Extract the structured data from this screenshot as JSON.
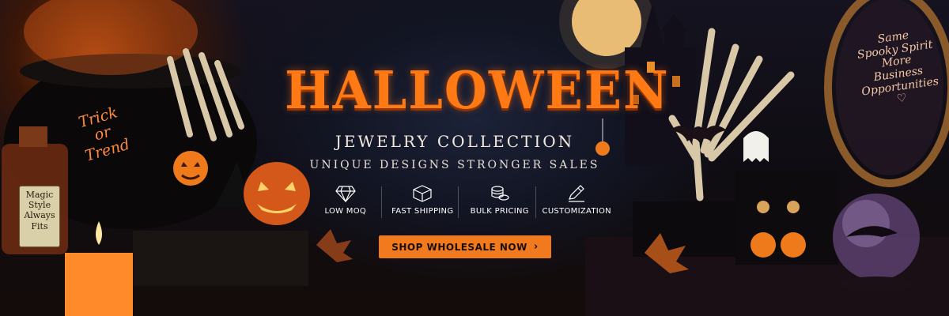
{
  "banner": {
    "title": "HALLOWEEN",
    "subtitle": "JEWELRY COLLECTION",
    "tagline": "UNIQUE DESIGNS  STRONGER SALES",
    "features": [
      {
        "icon": "diamond-icon",
        "label": "LOW MOQ"
      },
      {
        "icon": "box-icon",
        "label": "FAST SHIPPING"
      },
      {
        "icon": "coins-icon",
        "label": "BULK PRICING"
      },
      {
        "icon": "pencil-icon",
        "label": "CUSTOMIZATION"
      }
    ],
    "cta_label": "SHOP WHOLESALE NOW",
    "cta_icon": "chevron-right-icon"
  },
  "decor": {
    "trick_or_trend": [
      "Trick",
      "or",
      "Trend"
    ],
    "magic_label": [
      "Magic",
      "Style",
      "Always",
      "Fits"
    ],
    "mirror_text": [
      "Same",
      "Spooky Spirit",
      "More",
      "Business",
      "Opportunities",
      "♡"
    ]
  },
  "colors": {
    "accent": "#f07a1d",
    "title": "#ff7a14",
    "background": "#0f0c12",
    "moon": "#f3c47a"
  }
}
